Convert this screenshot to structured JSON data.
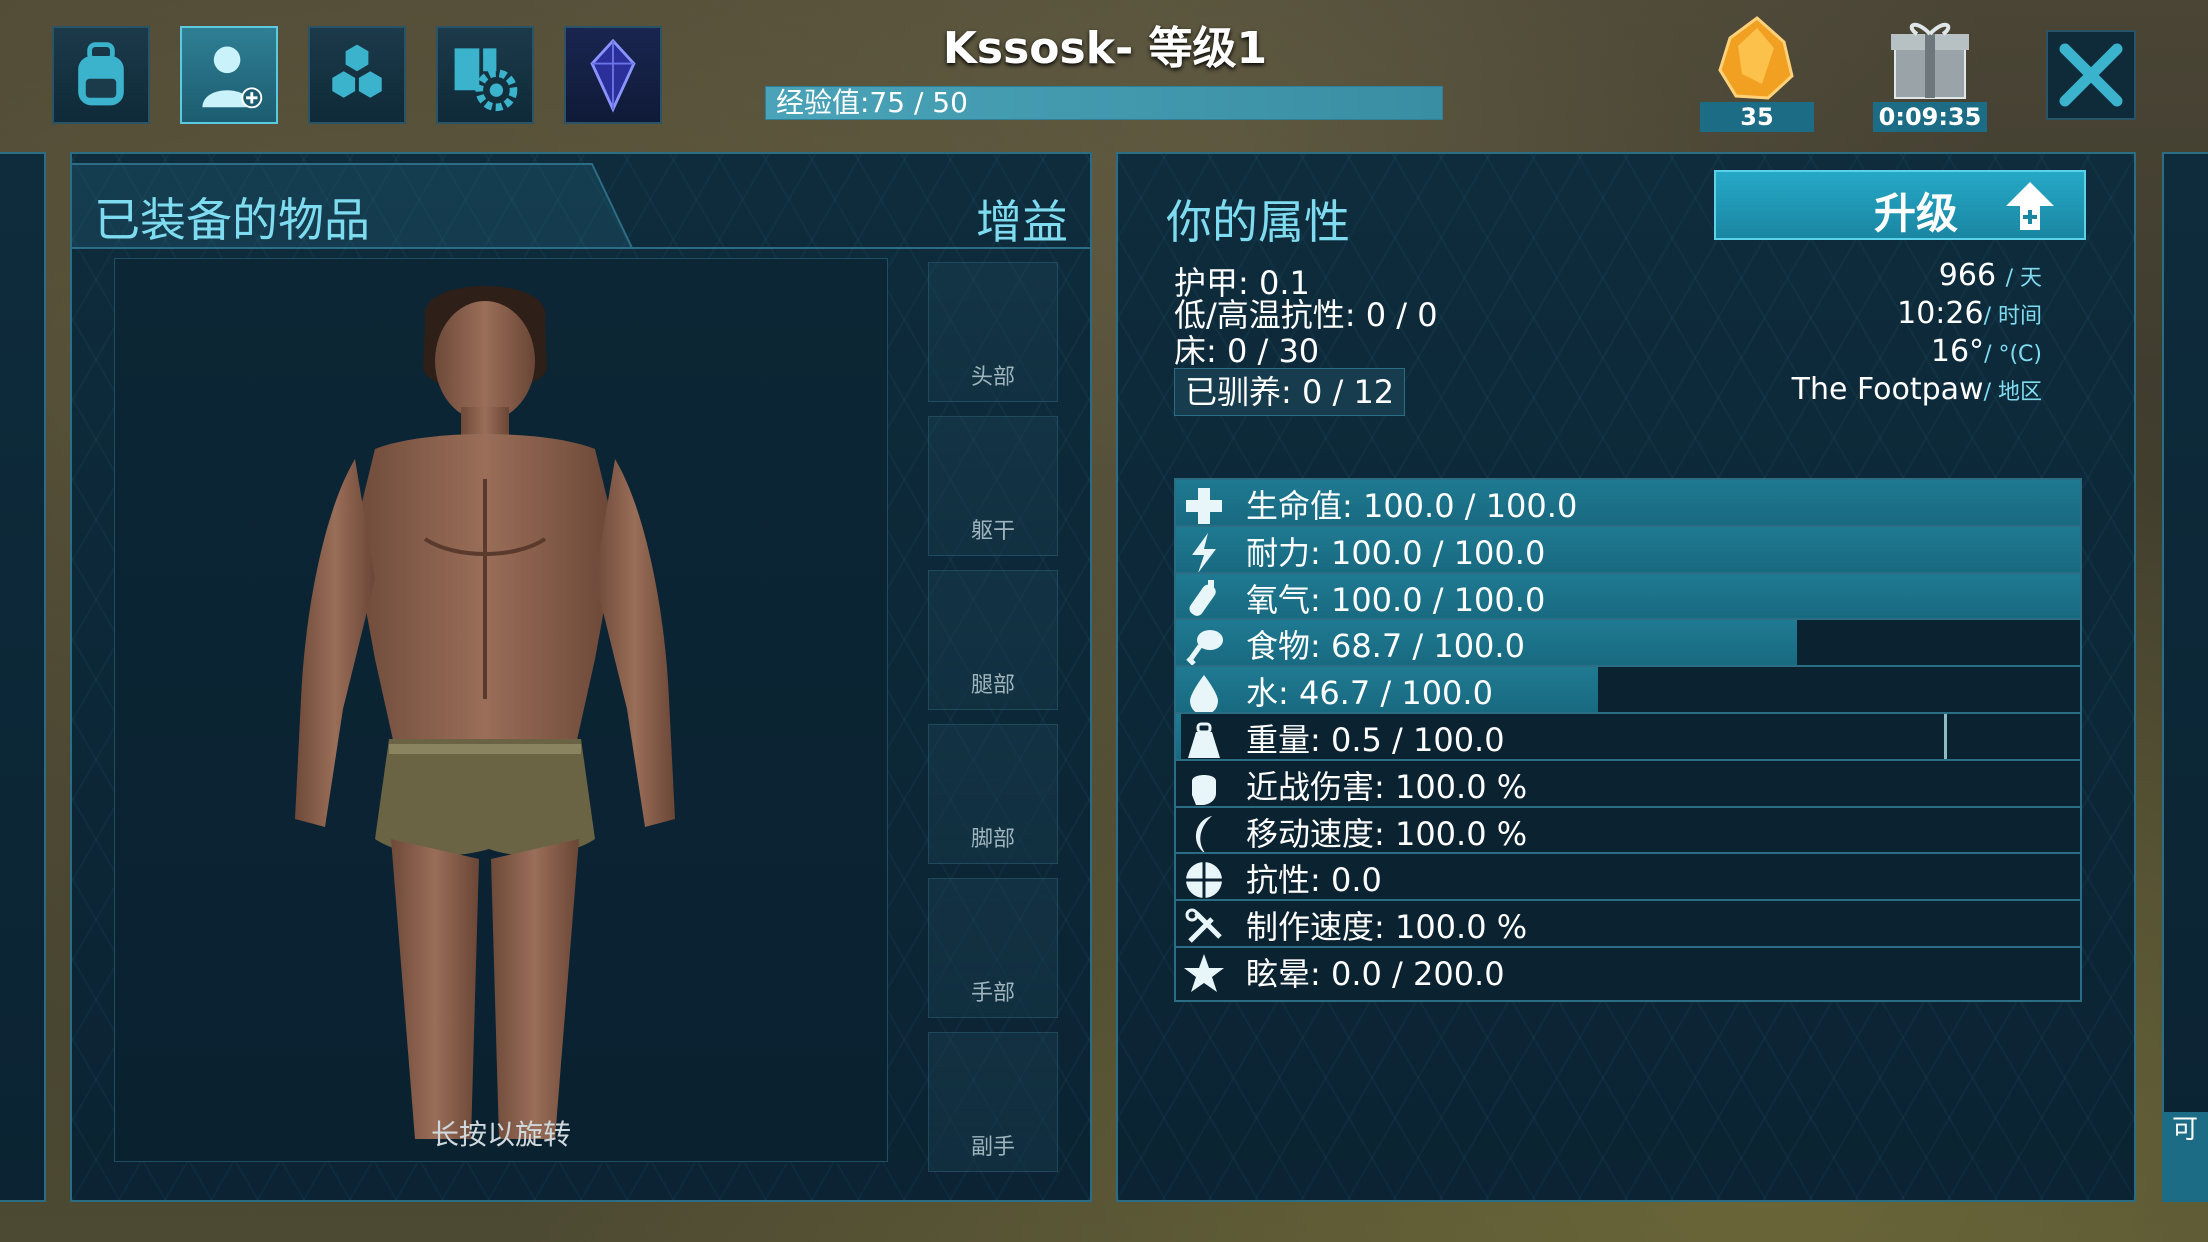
{
  "header": {
    "player_name": "Kssosk- 等级1",
    "xp_label": "经验值:75 / 50",
    "xp_progress": 1.0
  },
  "tabs": [
    {
      "name": "inventory",
      "icon": "backpack-icon"
    },
    {
      "name": "character",
      "icon": "character-icon",
      "active": true
    },
    {
      "name": "engrams",
      "icon": "hexagons-icon"
    },
    {
      "name": "settings",
      "icon": "book-gear-icon"
    },
    {
      "name": "tribe",
      "icon": "crystal-icon"
    }
  ],
  "resources": {
    "amber_count": "35",
    "gift_timer": "0:09:35"
  },
  "equipment": {
    "title": "已装备的物品",
    "buffs_label": "增益",
    "rotate_hint": "长按以旋转",
    "slots": [
      "头部",
      "躯干",
      "腿部",
      "脚部",
      "手部",
      "副手"
    ]
  },
  "attributes": {
    "title": "你的属性",
    "level_up_label": "升级",
    "armor": "护甲: 0.1",
    "temp_resist": "低/高温抗性: 0 / 0",
    "bed": "床: 0 / 30",
    "tamed": "已驯养: 0 / 12",
    "world": {
      "day_value": "966",
      "day_label": "/ 天",
      "time_value": "10:26",
      "time_label": "/ 时间",
      "temp_value": "16°",
      "temp_label": "/ °(C)",
      "region_value": "The Footpaw",
      "region_label": "/ 地区"
    },
    "stats": [
      {
        "label": "生命值: 100.0 / 100.0",
        "icon": "health-cross-icon",
        "fill": 1.0
      },
      {
        "label": "耐力: 100.0 / 100.0",
        "icon": "stamina-bolt-icon",
        "fill": 1.0
      },
      {
        "label": "氧气: 100.0 / 100.0",
        "icon": "oxygen-tank-icon",
        "fill": 1.0
      },
      {
        "label": "食物: 68.7 / 100.0",
        "icon": "food-drumstick-icon",
        "fill": 0.687
      },
      {
        "label": "水: 46.7 / 100.0",
        "icon": "water-drop-icon",
        "fill": 0.467
      },
      {
        "label": "重量: 0.5 / 100.0",
        "icon": "weight-icon",
        "fill": 0.005,
        "cap": 0.85
      },
      {
        "label": "近战伤害: 100.0 %",
        "icon": "melee-fist-icon",
        "fill": 0
      },
      {
        "label": "移动速度: 100.0 %",
        "icon": "movement-speed-icon",
        "fill": 0
      },
      {
        "label": "抗性: 0.0",
        "icon": "fortitude-icon",
        "fill": 0
      },
      {
        "label": "制作速度: 100.0 %",
        "icon": "crafting-tools-icon",
        "fill": 0
      },
      {
        "label": "眩晕: 0.0 / 200.0",
        "icon": "torpor-star-icon",
        "fill": 0
      }
    ]
  },
  "right_edge_label": "可",
  "colors": {
    "accent": "#7fdcf0",
    "bar_fill": "#1f7a92",
    "panel_border": "#2b6d85"
  }
}
